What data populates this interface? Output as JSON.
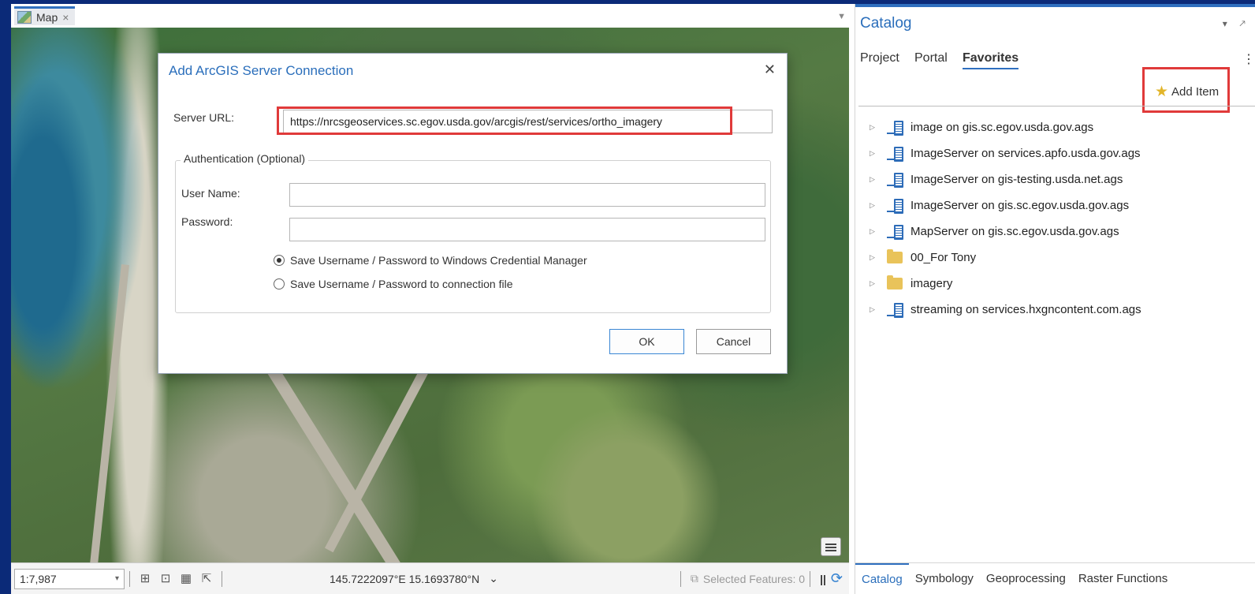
{
  "map_tab": {
    "label": "Map",
    "close": "×"
  },
  "status_bar": {
    "scale": "1:7,987",
    "coordinates": "145.7222097°E 15.1693780°N",
    "coord_dropdown": "⌄",
    "selected_features": "Selected Features: 0",
    "pause": "||",
    "refresh": "⟳"
  },
  "dialog": {
    "title": "Add ArcGIS Server Connection",
    "close": "✕",
    "server_url_label": "Server URL:",
    "server_url_value": "https://nrcsgeoservices.sc.egov.usda.gov/arcgis/rest/services/ortho_imagery",
    "auth_legend": "Authentication (Optional)",
    "username_label": "User Name:",
    "username_value": "",
    "password_label": "Password:",
    "password_value": "",
    "radio_options": [
      {
        "label": "Save Username / Password to Windows Credential Manager",
        "checked": true
      },
      {
        "label": "Save Username / Password to connection file",
        "checked": false
      }
    ],
    "ok_label": "OK",
    "cancel_label": "Cancel"
  },
  "catalog": {
    "title": "Catalog",
    "pin": "▾ 🡕",
    "tabs": [
      "Project",
      "Portal",
      "Favorites"
    ],
    "active_tab": "Favorites",
    "kebab": "⋮",
    "add_item_label": "Add Item",
    "items": [
      {
        "label": "image on gis.sc.egov.usda.gov.ags",
        "icon": "server-icon"
      },
      {
        "label": "ImageServer on services.apfo.usda.gov.ags",
        "icon": "server-icon"
      },
      {
        "label": "ImageServer on gis-testing.usda.net.ags",
        "icon": "server-icon"
      },
      {
        "label": "ImageServer on gis.sc.egov.usda.gov.ags",
        "icon": "server-icon"
      },
      {
        "label": "MapServer on gis.sc.egov.usda.gov.ags",
        "icon": "server-icon"
      },
      {
        "label": "00_For Tony",
        "icon": "folder-icon"
      },
      {
        "label": "imagery",
        "icon": "folder-icon"
      },
      {
        "label": "streaming on services.hxgncontent.com.ags",
        "icon": "server-icon"
      }
    ],
    "bottom_tabs": [
      "Catalog",
      "Symbology",
      "Geoprocessing",
      "Raster Functions"
    ],
    "active_bottom_tab": "Catalog"
  },
  "colors": {
    "accent": "#2f6fbf",
    "title_blue": "#2a6ebb",
    "highlight_red": "#e03a3a",
    "folder_yellow": "#e9c35a"
  }
}
